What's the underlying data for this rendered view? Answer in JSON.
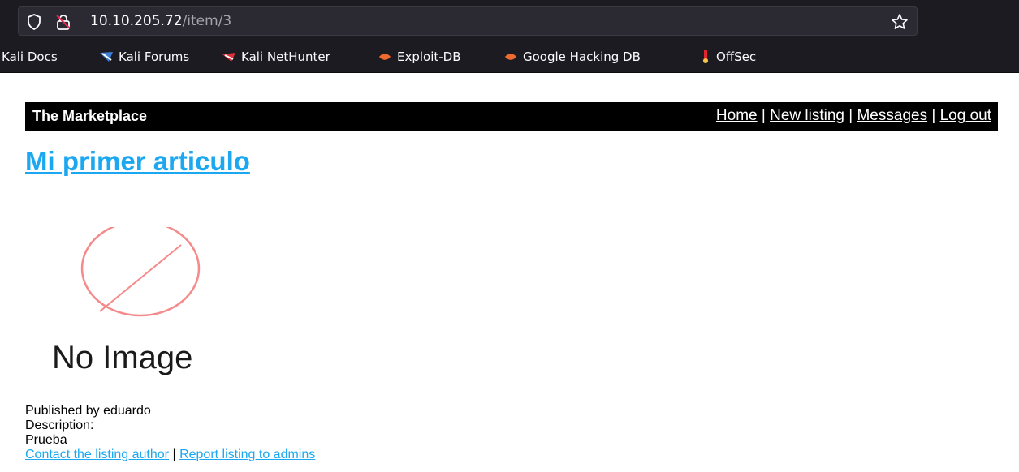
{
  "browser": {
    "url_host": "10.10.205.72",
    "url_path": "/item/3",
    "bookmarks": [
      {
        "label": "Kali Docs",
        "icon": "kali-docs-icon"
      },
      {
        "label": "Kali Forums",
        "icon": "kali-forums-icon"
      },
      {
        "label": "Kali NetHunter",
        "icon": "kali-nethunter-icon"
      },
      {
        "label": "Exploit-DB",
        "icon": "exploit-db-icon"
      },
      {
        "label": "Google Hacking DB",
        "icon": "google-hacking-db-icon"
      },
      {
        "label": "OffSec",
        "icon": "offsec-icon"
      }
    ]
  },
  "site": {
    "title": "The Marketplace",
    "nav": {
      "home": "Home",
      "new_listing": "New listing",
      "messages": "Messages",
      "logout": "Log out",
      "separator": "|"
    }
  },
  "item": {
    "title": "Mi primer articulo",
    "image_text": "No Image",
    "published_by": "Published by eduardo",
    "description_label": "Description:",
    "description": "Prueba",
    "contact_link": "Contact the listing author",
    "report_link": "Report listing to admins",
    "link_separator": "|"
  },
  "colors": {
    "link": "#1ba8f0",
    "header_bg": "#000000",
    "no_image_circle": "#f58a8a"
  }
}
